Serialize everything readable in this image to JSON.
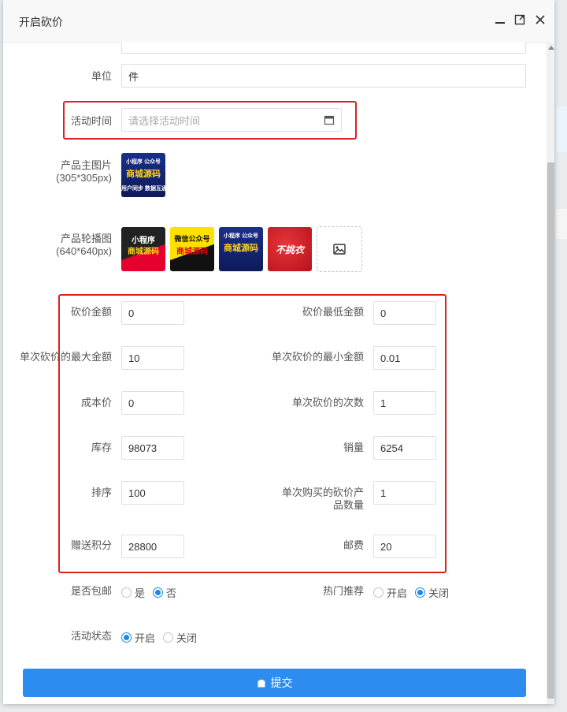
{
  "modal": {
    "title": "开启砍价"
  },
  "form": {
    "unit": {
      "label": "单位",
      "value": "件"
    },
    "activity_time": {
      "label": "活动时间",
      "placeholder": "请选择活动时间"
    },
    "main_image": {
      "label": "产品主图片",
      "hint": "(305*305px)"
    },
    "carousel": {
      "label": "产品轮播图",
      "hint": "(640*640px)"
    },
    "bargain_amount": {
      "label": "砍价金额",
      "value": "0"
    },
    "min_bargain_amount": {
      "label": "砍价最低金额",
      "value": "0"
    },
    "max_single_bargain": {
      "label": "单次砍价的最大金额",
      "value": "10"
    },
    "min_single_bargain": {
      "label": "单次砍价的最小金额",
      "value": "0.01"
    },
    "cost_price": {
      "label": "成本价",
      "value": "0"
    },
    "bargain_times": {
      "label": "单次砍价的次数",
      "value": "1"
    },
    "stock": {
      "label": "库存",
      "value": "98073"
    },
    "sales": {
      "label": "销量",
      "value": "6254"
    },
    "sort": {
      "label": "排序",
      "value": "100"
    },
    "purchase_qty": {
      "label": "单次购买的砍价产品数量",
      "value": "1"
    },
    "gift_points": {
      "label": "赠送积分",
      "value": "28800"
    },
    "postage": {
      "label": "邮费",
      "value": "20"
    },
    "free_shipping": {
      "label": "是否包邮",
      "options": [
        "是",
        "否"
      ],
      "selected": "否"
    },
    "hot_recommend": {
      "label": "热门推荐",
      "options": [
        "开启",
        "关闭"
      ],
      "selected": "关闭"
    },
    "activity_status": {
      "label": "活动状态",
      "options": [
        "开启",
        "关闭"
      ],
      "selected": "开启"
    }
  },
  "images": {
    "main": {
      "badge": "小程序 公众号",
      "title": "商城源码",
      "sub": "用户同步 数据互通"
    },
    "carousel": [
      {
        "top": "小程序",
        "title": "商城源码"
      },
      {
        "top": "微信公众号",
        "title": "商城源码"
      },
      {
        "top": "小程序 公众号",
        "title": "商城源码"
      },
      {
        "top": "",
        "title": "不挑衣"
      }
    ]
  },
  "submit_label": "提交",
  "colors": {
    "primary": "#2d8cf0",
    "highlight": "#e02020",
    "radio": "#1e88e5"
  }
}
